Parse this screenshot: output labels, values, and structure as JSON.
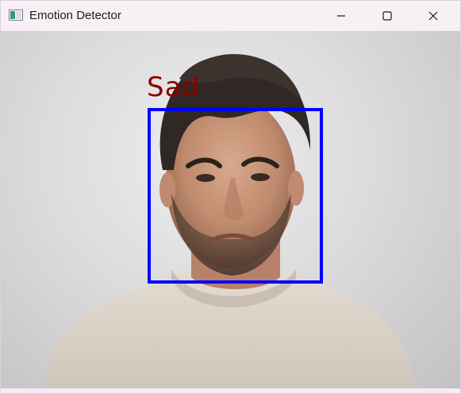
{
  "window": {
    "title": "Emotion Detector",
    "icon": "app-window-icon",
    "controls": [
      "minimize-icon",
      "maximize-icon",
      "close-icon"
    ]
  },
  "detection": {
    "emotion_label": "Sad",
    "label_color": "#8b0000",
    "box_color": "#0000ff"
  },
  "colors": {
    "titlebar_bg": "#f7f0f5",
    "canvas_bg": "#dcdcde"
  }
}
